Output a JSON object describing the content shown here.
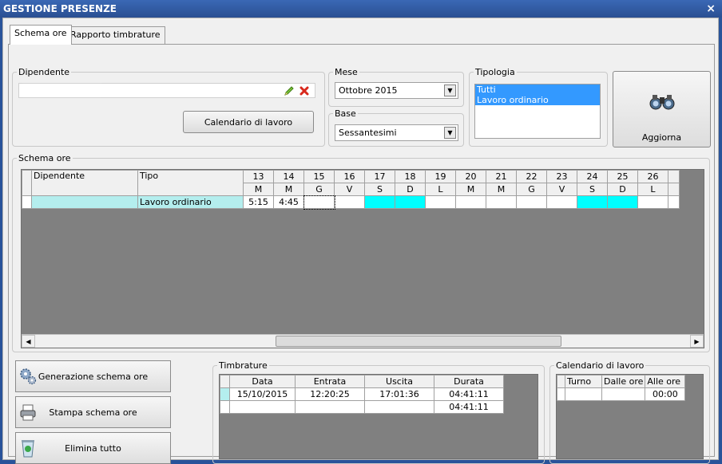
{
  "window": {
    "title": "GESTIONE PRESENZE",
    "close": "×"
  },
  "tabs": [
    {
      "label": "Schema ore"
    },
    {
      "label": "Rapporto timbrature"
    }
  ],
  "dipendente": {
    "legend": "Dipendente",
    "value": "",
    "calendar_button": "Calendario di lavoro"
  },
  "mese": {
    "legend": "Mese",
    "value": "Ottobre 2015"
  },
  "base": {
    "legend": "Base",
    "value": "Sessantesimi"
  },
  "tipologia": {
    "legend": "Tipologia",
    "options": [
      "Tutti",
      "Lavoro ordinario"
    ]
  },
  "aggiorna": {
    "label": "Aggiorna",
    "icon": "binoculars-icon"
  },
  "schema": {
    "legend": "Schema ore",
    "col_dipendente": "Dipendente",
    "col_tipo": "Tipo",
    "days": [
      "13",
      "14",
      "15",
      "16",
      "17",
      "18",
      "19",
      "20",
      "21",
      "22",
      "23",
      "24",
      "25",
      "26"
    ],
    "weekdays": [
      "M",
      "M",
      "G",
      "V",
      "S",
      "D",
      "L",
      "M",
      "M",
      "G",
      "V",
      "S",
      "D",
      "L"
    ],
    "weekend_flags": [
      false,
      false,
      false,
      false,
      true,
      true,
      false,
      false,
      false,
      false,
      false,
      true,
      true,
      false
    ],
    "row": {
      "dipendente": "",
      "tipo": "Lavoro ordinario",
      "values": [
        "5:15",
        "4:45",
        "",
        "",
        "",
        "",
        "",
        "",
        "",
        "",
        "",
        "",
        "",
        ""
      ]
    }
  },
  "buttons": {
    "genera": "Generazione schema ore",
    "stampa": "Stampa schema ore",
    "elimina": "Elimina tutto"
  },
  "timbrature": {
    "legend": "Timbrature",
    "headers": [
      "Data",
      "Entrata",
      "Uscita",
      "Durata"
    ],
    "rows": [
      [
        "15/10/2015",
        "12:20:25",
        "17:01:36",
        "04:41:11"
      ],
      [
        "",
        "",
        "",
        "04:41:11"
      ]
    ]
  },
  "calendario": {
    "legend": "Calendario di lavoro",
    "headers": [
      "Turno",
      "Dalle ore",
      "Alle ore"
    ],
    "rows": [
      [
        "",
        "",
        "00:00"
      ]
    ]
  },
  "colors": {
    "titlebar": "#2a4f92",
    "weekend": "#00ffff",
    "selection": "#3399ff",
    "grid_bg": "#808080"
  }
}
